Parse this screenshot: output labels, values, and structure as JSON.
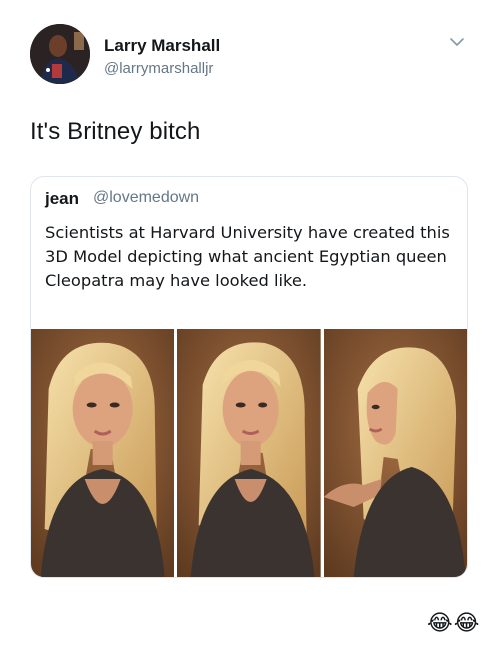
{
  "tweet": {
    "author_name": "Larry Marshall",
    "author_handle": "@larrymarshalljr",
    "text": "It's Britney bitch",
    "menu_icon": "chevron-down-icon",
    "reaction_emoji": "😂😂"
  },
  "quoted_tweet": {
    "author_name": "jean",
    "author_handle": "@lovemedown",
    "text": "Scientists at Harvard University have created this 3D Model depicting what ancient Egyptian queen Cleopatra may have looked like."
  },
  "media": {
    "panels": [
      "front-view",
      "three-quarter-view",
      "side-view"
    ],
    "colors": {
      "background": "#8a5a36",
      "hair": "#e8c888",
      "skin": "#d9a07c",
      "outfit": "#3a3330"
    }
  }
}
